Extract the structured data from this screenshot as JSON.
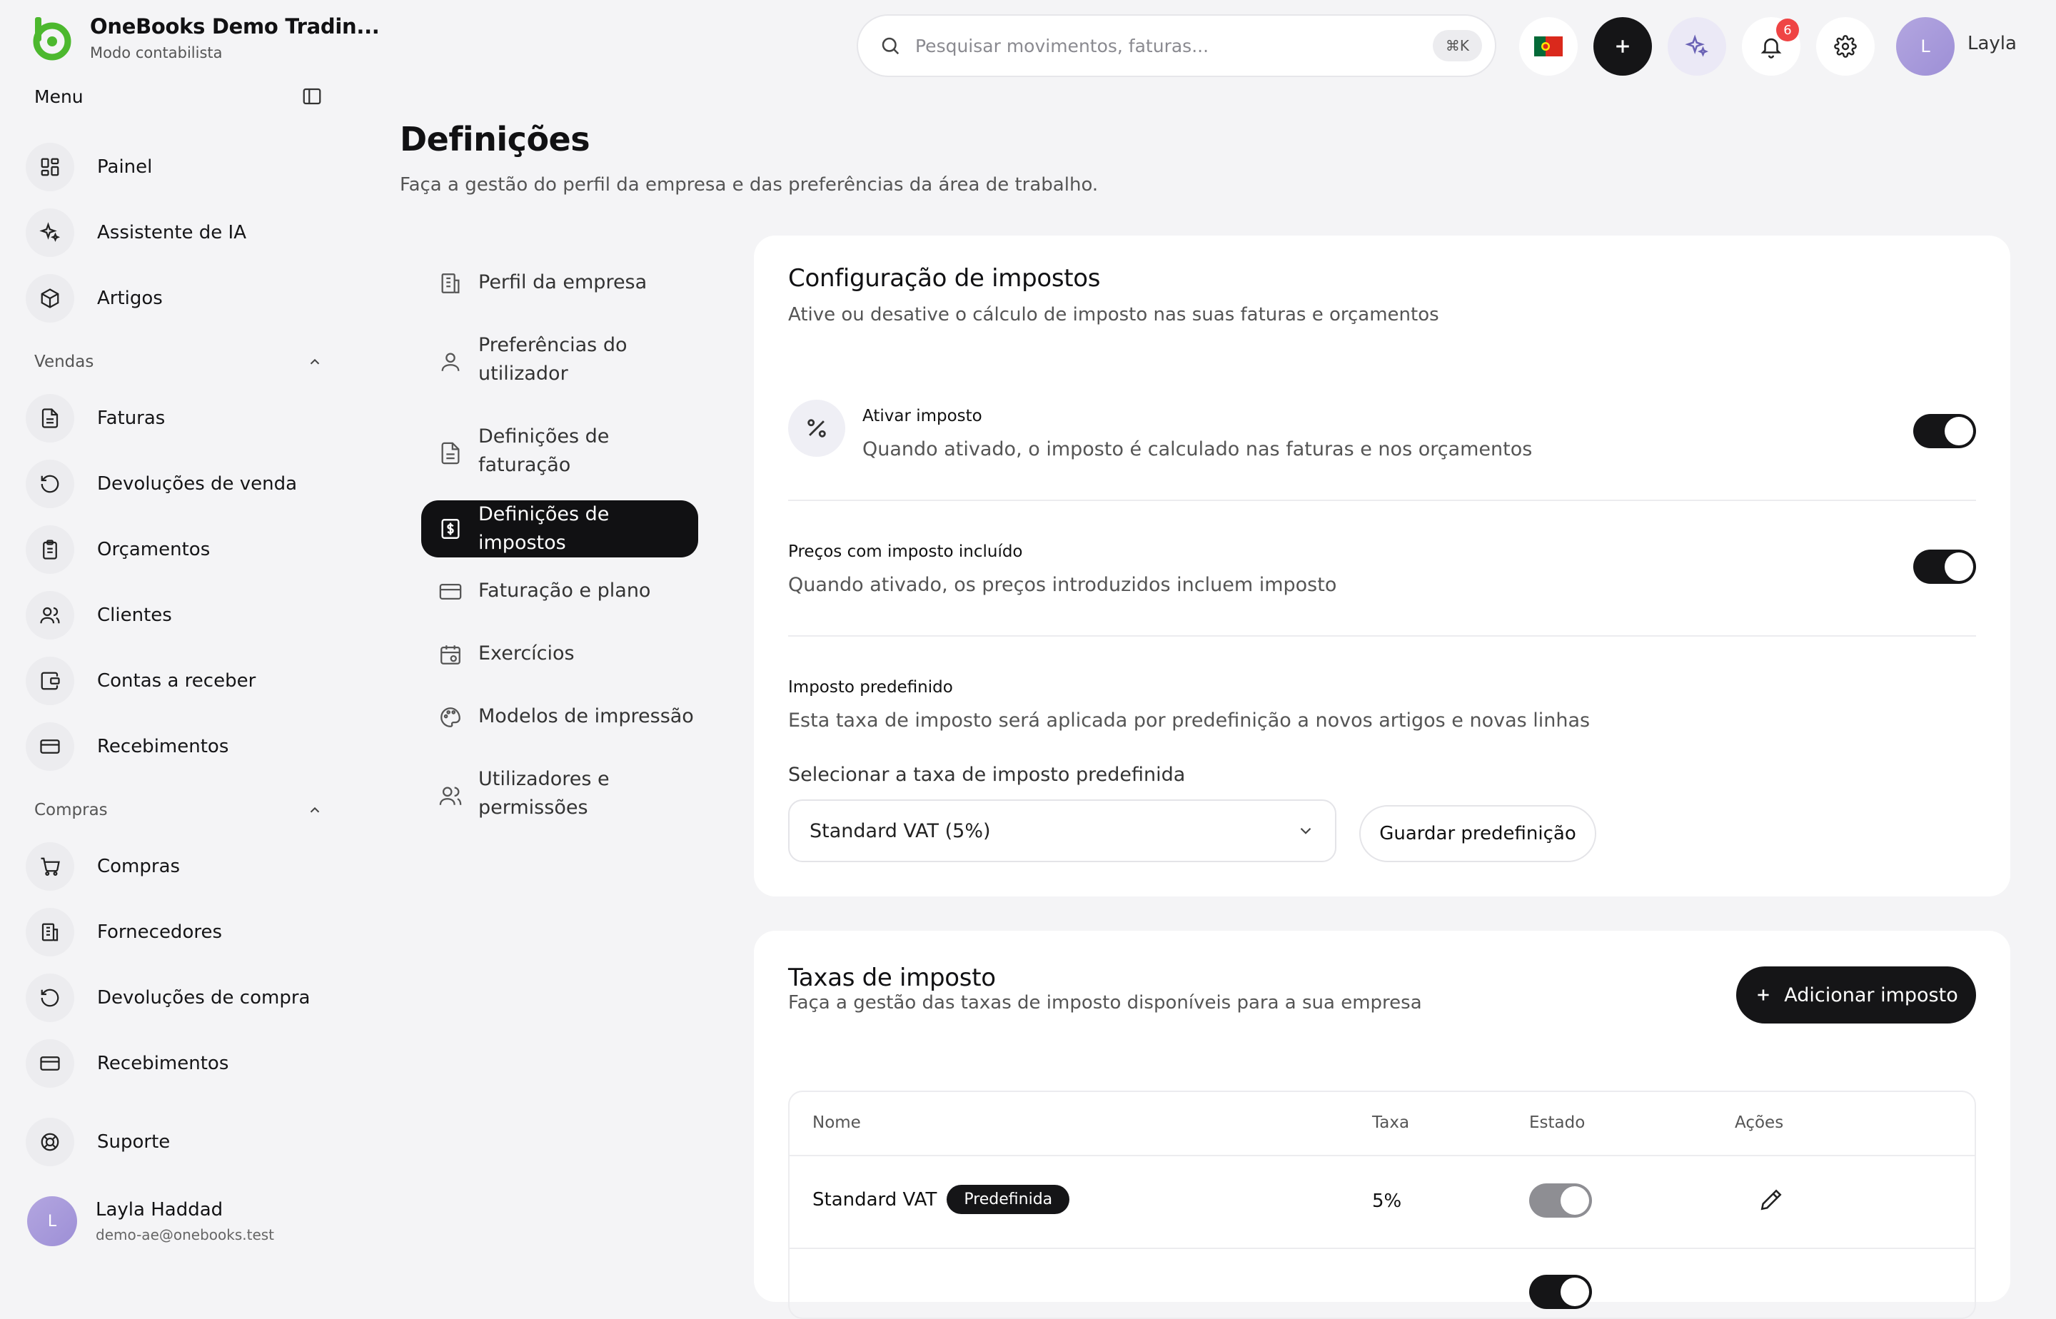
{
  "app": {
    "company": "OneBooks Demo Tradin...",
    "mode": "Modo contabilista"
  },
  "sidebar": {
    "menu_label": "Menu",
    "top_items": [
      {
        "label": "Painel",
        "icon": "dashboard-icon"
      },
      {
        "label": "Assistente de IA",
        "icon": "sparkles-icon"
      },
      {
        "label": "Artigos",
        "icon": "box-icon"
      }
    ],
    "sales_label": "Vendas",
    "sales_items": [
      {
        "label": "Faturas",
        "icon": "file-icon"
      },
      {
        "label": "Devoluções de venda",
        "icon": "rotate-icon"
      },
      {
        "label": "Orçamentos",
        "icon": "clipboard-icon"
      },
      {
        "label": "Clientes",
        "icon": "users-icon"
      },
      {
        "label": "Contas a receber",
        "icon": "wallet-icon"
      },
      {
        "label": "Recebimentos",
        "icon": "credit-card-icon"
      }
    ],
    "purchases_label": "Compras",
    "purchase_items": [
      {
        "label": "Compras",
        "icon": "cart-icon"
      },
      {
        "label": "Fornecedores",
        "icon": "building-icon"
      },
      {
        "label": "Devoluções de compra",
        "icon": "rotate-icon"
      },
      {
        "label": "Recebimentos",
        "icon": "credit-card-icon"
      }
    ],
    "support_label": "Suporte",
    "user": {
      "initial": "L",
      "name": "Layla Haddad",
      "email": "demo-ae@onebooks.test"
    }
  },
  "topbar": {
    "search_placeholder": "Pesquisar movimentos, faturas...",
    "shortcut": "⌘K",
    "notification_count": "6",
    "user_initial": "L",
    "user_name": "Layla"
  },
  "page": {
    "title": "Definições",
    "subtitle": "Faça a gestão do perfil da empresa e das preferências da área de trabalho."
  },
  "settings_nav": [
    {
      "label": "Perfil da empresa",
      "icon": "building-icon",
      "active": false
    },
    {
      "label": "Preferências do utilizador",
      "icon": "user-icon",
      "active": false
    },
    {
      "label": "Definições de faturação",
      "icon": "file-icon",
      "active": false
    },
    {
      "label": "Definições de impostos",
      "icon": "receipt-dollar-icon",
      "active": true
    },
    {
      "label": "Faturação e plano",
      "icon": "credit-card-icon",
      "active": false
    },
    {
      "label": "Exercícios",
      "icon": "calendar-icon",
      "active": false
    },
    {
      "label": "Modelos de impressão",
      "icon": "palette-icon",
      "active": false
    },
    {
      "label": "Utilizadores e permissões",
      "icon": "users-icon",
      "active": false
    }
  ],
  "tax_config": {
    "title": "Configuração de impostos",
    "subtitle": "Ative ou desative o cálculo de imposto nas suas faturas e orçamentos",
    "enable_tax": {
      "title": "Ativar imposto",
      "desc": "Quando ativado, o imposto é calculado nas faturas e nos orçamentos",
      "on": true
    },
    "tax_inclusive": {
      "title": "Preços com imposto incluído",
      "desc": "Quando ativado, os preços introduzidos incluem imposto",
      "on": true
    },
    "default_tax": {
      "title": "Imposto predefinido",
      "desc": "Esta taxa de imposto será aplicada por predefinição a novos artigos e novas linhas",
      "select_label": "Selecionar a taxa de imposto predefinida",
      "selected": "Standard VAT (5%)",
      "save_label": "Guardar predefinição"
    }
  },
  "tax_rates": {
    "title": "Taxas de imposto",
    "subtitle": "Faça a gestão das taxas de imposto disponíveis para a sua empresa",
    "add_label": "Adicionar imposto",
    "columns": [
      "Nome",
      "Taxa",
      "Estado",
      "Ações"
    ],
    "rows": [
      {
        "name": "Standard VAT",
        "badge": "Predefinida",
        "rate": "5%",
        "active": true
      }
    ]
  },
  "colors": {
    "accent_green": "#4cb82e",
    "dark": "#151517",
    "background": "#f4f4f6",
    "notification": "#ef4444"
  }
}
